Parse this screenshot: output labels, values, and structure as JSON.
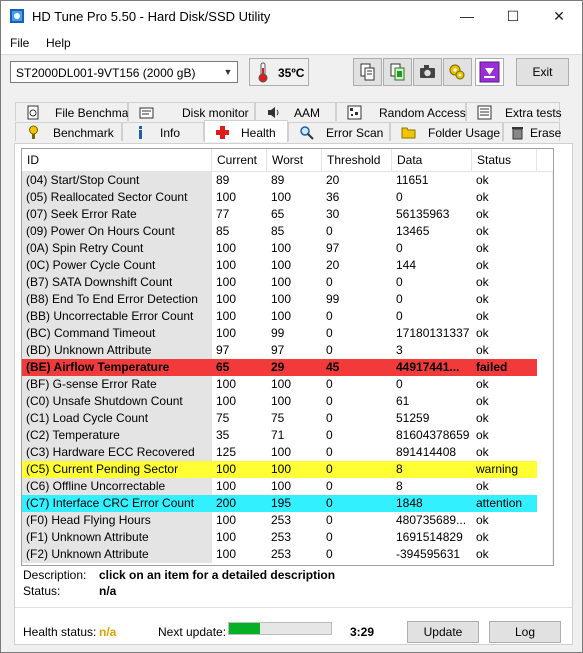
{
  "window": {
    "title": "HD Tune Pro 5.50 - Hard Disk/SSD Utility",
    "minimize": "—",
    "maximize": "☐",
    "close": "✕"
  },
  "menu": [
    "File",
    "Help"
  ],
  "toolbar": {
    "drive": "ST2000DL001-9VT156 (2000 gB)",
    "temperature": "35ºC",
    "exit_label": "Exit",
    "icons": [
      "copy-info-icon",
      "copy-screen-icon",
      "camera-icon",
      "options-icon",
      "save-icon"
    ]
  },
  "tabs_top": [
    {
      "label": "File Benchmark",
      "icon": "file-benchmark-icon"
    },
    {
      "label": "Disk monitor",
      "icon": "disk-monitor-icon"
    },
    {
      "label": "AAM",
      "icon": "speaker-icon"
    },
    {
      "label": "Random Access",
      "icon": "random-access-icon"
    },
    {
      "label": "Extra tests",
      "icon": "extra-tests-icon"
    }
  ],
  "tabs_bottom": [
    {
      "label": "Benchmark",
      "icon": "benchmark-icon"
    },
    {
      "label": "Info",
      "icon": "info-icon"
    },
    {
      "label": "Health",
      "icon": "health-cross-icon",
      "active": true
    },
    {
      "label": "Error Scan",
      "icon": "magnifier-icon"
    },
    {
      "label": "Folder Usage",
      "icon": "folder-icon"
    },
    {
      "label": "Erase",
      "icon": "trash-icon"
    }
  ],
  "table": {
    "columns": [
      "ID",
      "Current",
      "Worst",
      "Threshold",
      "Data",
      "Status"
    ],
    "rows": [
      {
        "id": "(04) Start/Stop Count",
        "current": "89",
        "worst": "89",
        "threshold": "20",
        "data": "11651",
        "status": "ok",
        "highlight": ""
      },
      {
        "id": "(05) Reallocated Sector Count",
        "current": "100",
        "worst": "100",
        "threshold": "36",
        "data": "0",
        "status": "ok",
        "highlight": ""
      },
      {
        "id": "(07) Seek Error Rate",
        "current": "77",
        "worst": "65",
        "threshold": "30",
        "data": "56135963",
        "status": "ok",
        "highlight": ""
      },
      {
        "id": "(09) Power On Hours Count",
        "current": "85",
        "worst": "85",
        "threshold": "0",
        "data": "13465",
        "status": "ok",
        "highlight": ""
      },
      {
        "id": "(0A) Spin Retry Count",
        "current": "100",
        "worst": "100",
        "threshold": "97",
        "data": "0",
        "status": "ok",
        "highlight": ""
      },
      {
        "id": "(0C) Power Cycle Count",
        "current": "100",
        "worst": "100",
        "threshold": "20",
        "data": "144",
        "status": "ok",
        "highlight": ""
      },
      {
        "id": "(B7) SATA Downshift Count",
        "current": "100",
        "worst": "100",
        "threshold": "0",
        "data": "0",
        "status": "ok",
        "highlight": ""
      },
      {
        "id": "(B8) End To End Error Detection",
        "current": "100",
        "worst": "100",
        "threshold": "99",
        "data": "0",
        "status": "ok",
        "highlight": ""
      },
      {
        "id": "(BB) Uncorrectable Error Count",
        "current": "100",
        "worst": "100",
        "threshold": "0",
        "data": "0",
        "status": "ok",
        "highlight": ""
      },
      {
        "id": "(BC) Command Timeout",
        "current": "100",
        "worst": "99",
        "threshold": "0",
        "data": "17180131337",
        "status": "ok",
        "highlight": ""
      },
      {
        "id": "(BD) Unknown Attribute",
        "current": "97",
        "worst": "97",
        "threshold": "0",
        "data": "3",
        "status": "ok",
        "highlight": ""
      },
      {
        "id": "(BE) Airflow Temperature",
        "current": "65",
        "worst": "29",
        "threshold": "45",
        "data": "44917441...",
        "status": "failed",
        "highlight": "red"
      },
      {
        "id": "(BF) G-sense Error Rate",
        "current": "100",
        "worst": "100",
        "threshold": "0",
        "data": "0",
        "status": "ok",
        "highlight": ""
      },
      {
        "id": "(C0) Unsafe Shutdown Count",
        "current": "100",
        "worst": "100",
        "threshold": "0",
        "data": "61",
        "status": "ok",
        "highlight": ""
      },
      {
        "id": "(C1) Load Cycle Count",
        "current": "75",
        "worst": "75",
        "threshold": "0",
        "data": "51259",
        "status": "ok",
        "highlight": ""
      },
      {
        "id": "(C2) Temperature",
        "current": "35",
        "worst": "71",
        "threshold": "0",
        "data": "81604378659",
        "status": "ok",
        "highlight": ""
      },
      {
        "id": "(C3) Hardware ECC Recovered",
        "current": "125",
        "worst": "100",
        "threshold": "0",
        "data": "891414408",
        "status": "ok",
        "highlight": ""
      },
      {
        "id": "(C5) Current Pending Sector",
        "current": "100",
        "worst": "100",
        "threshold": "0",
        "data": "8",
        "status": "warning",
        "highlight": "yellow"
      },
      {
        "id": "(C6) Offline Uncorrectable",
        "current": "100",
        "worst": "100",
        "threshold": "0",
        "data": "8",
        "status": "ok",
        "highlight": ""
      },
      {
        "id": "(C7) Interface CRC Error Count",
        "current": "200",
        "worst": "195",
        "threshold": "0",
        "data": "1848",
        "status": "attention",
        "highlight": "cyan"
      },
      {
        "id": "(F0) Head Flying Hours",
        "current": "100",
        "worst": "253",
        "threshold": "0",
        "data": "480735689...",
        "status": "ok",
        "highlight": ""
      },
      {
        "id": "(F1) Unknown Attribute",
        "current": "100",
        "worst": "253",
        "threshold": "0",
        "data": "1691514829",
        "status": "ok",
        "highlight": ""
      },
      {
        "id": "(F2) Unknown Attribute",
        "current": "100",
        "worst": "253",
        "threshold": "0",
        "data": "-394595631",
        "status": "ok",
        "highlight": ""
      }
    ]
  },
  "colors": {
    "red": "#f23a3a",
    "yellow": "#ffff33",
    "cyan": "#33f0ff",
    "orange_text": "#e0a000",
    "progress_green": "#06b025"
  },
  "description": {
    "label": "Description:",
    "value": "click on an item for a detailed description",
    "status_label": "Status:",
    "status_value": "n/a"
  },
  "footer": {
    "health_label": "Health status:",
    "health_value": "n/a",
    "next_update_label": "Next update:",
    "progress_fraction": 0.3,
    "time": "3:29",
    "update_label": "Update",
    "log_label": "Log"
  }
}
